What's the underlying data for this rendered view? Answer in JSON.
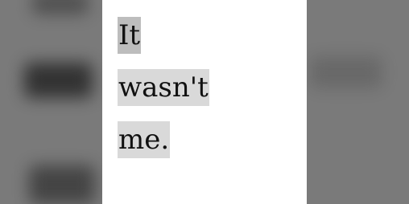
{
  "content": {
    "lines": [
      "It",
      "wasn't",
      "me."
    ]
  },
  "colors": {
    "outside_background": "#7a7a7a",
    "card_background": "#ffffff",
    "highlight_primary": "#bdbdbd",
    "highlight_secondary": "#d9d9d9",
    "text": "#111111"
  }
}
